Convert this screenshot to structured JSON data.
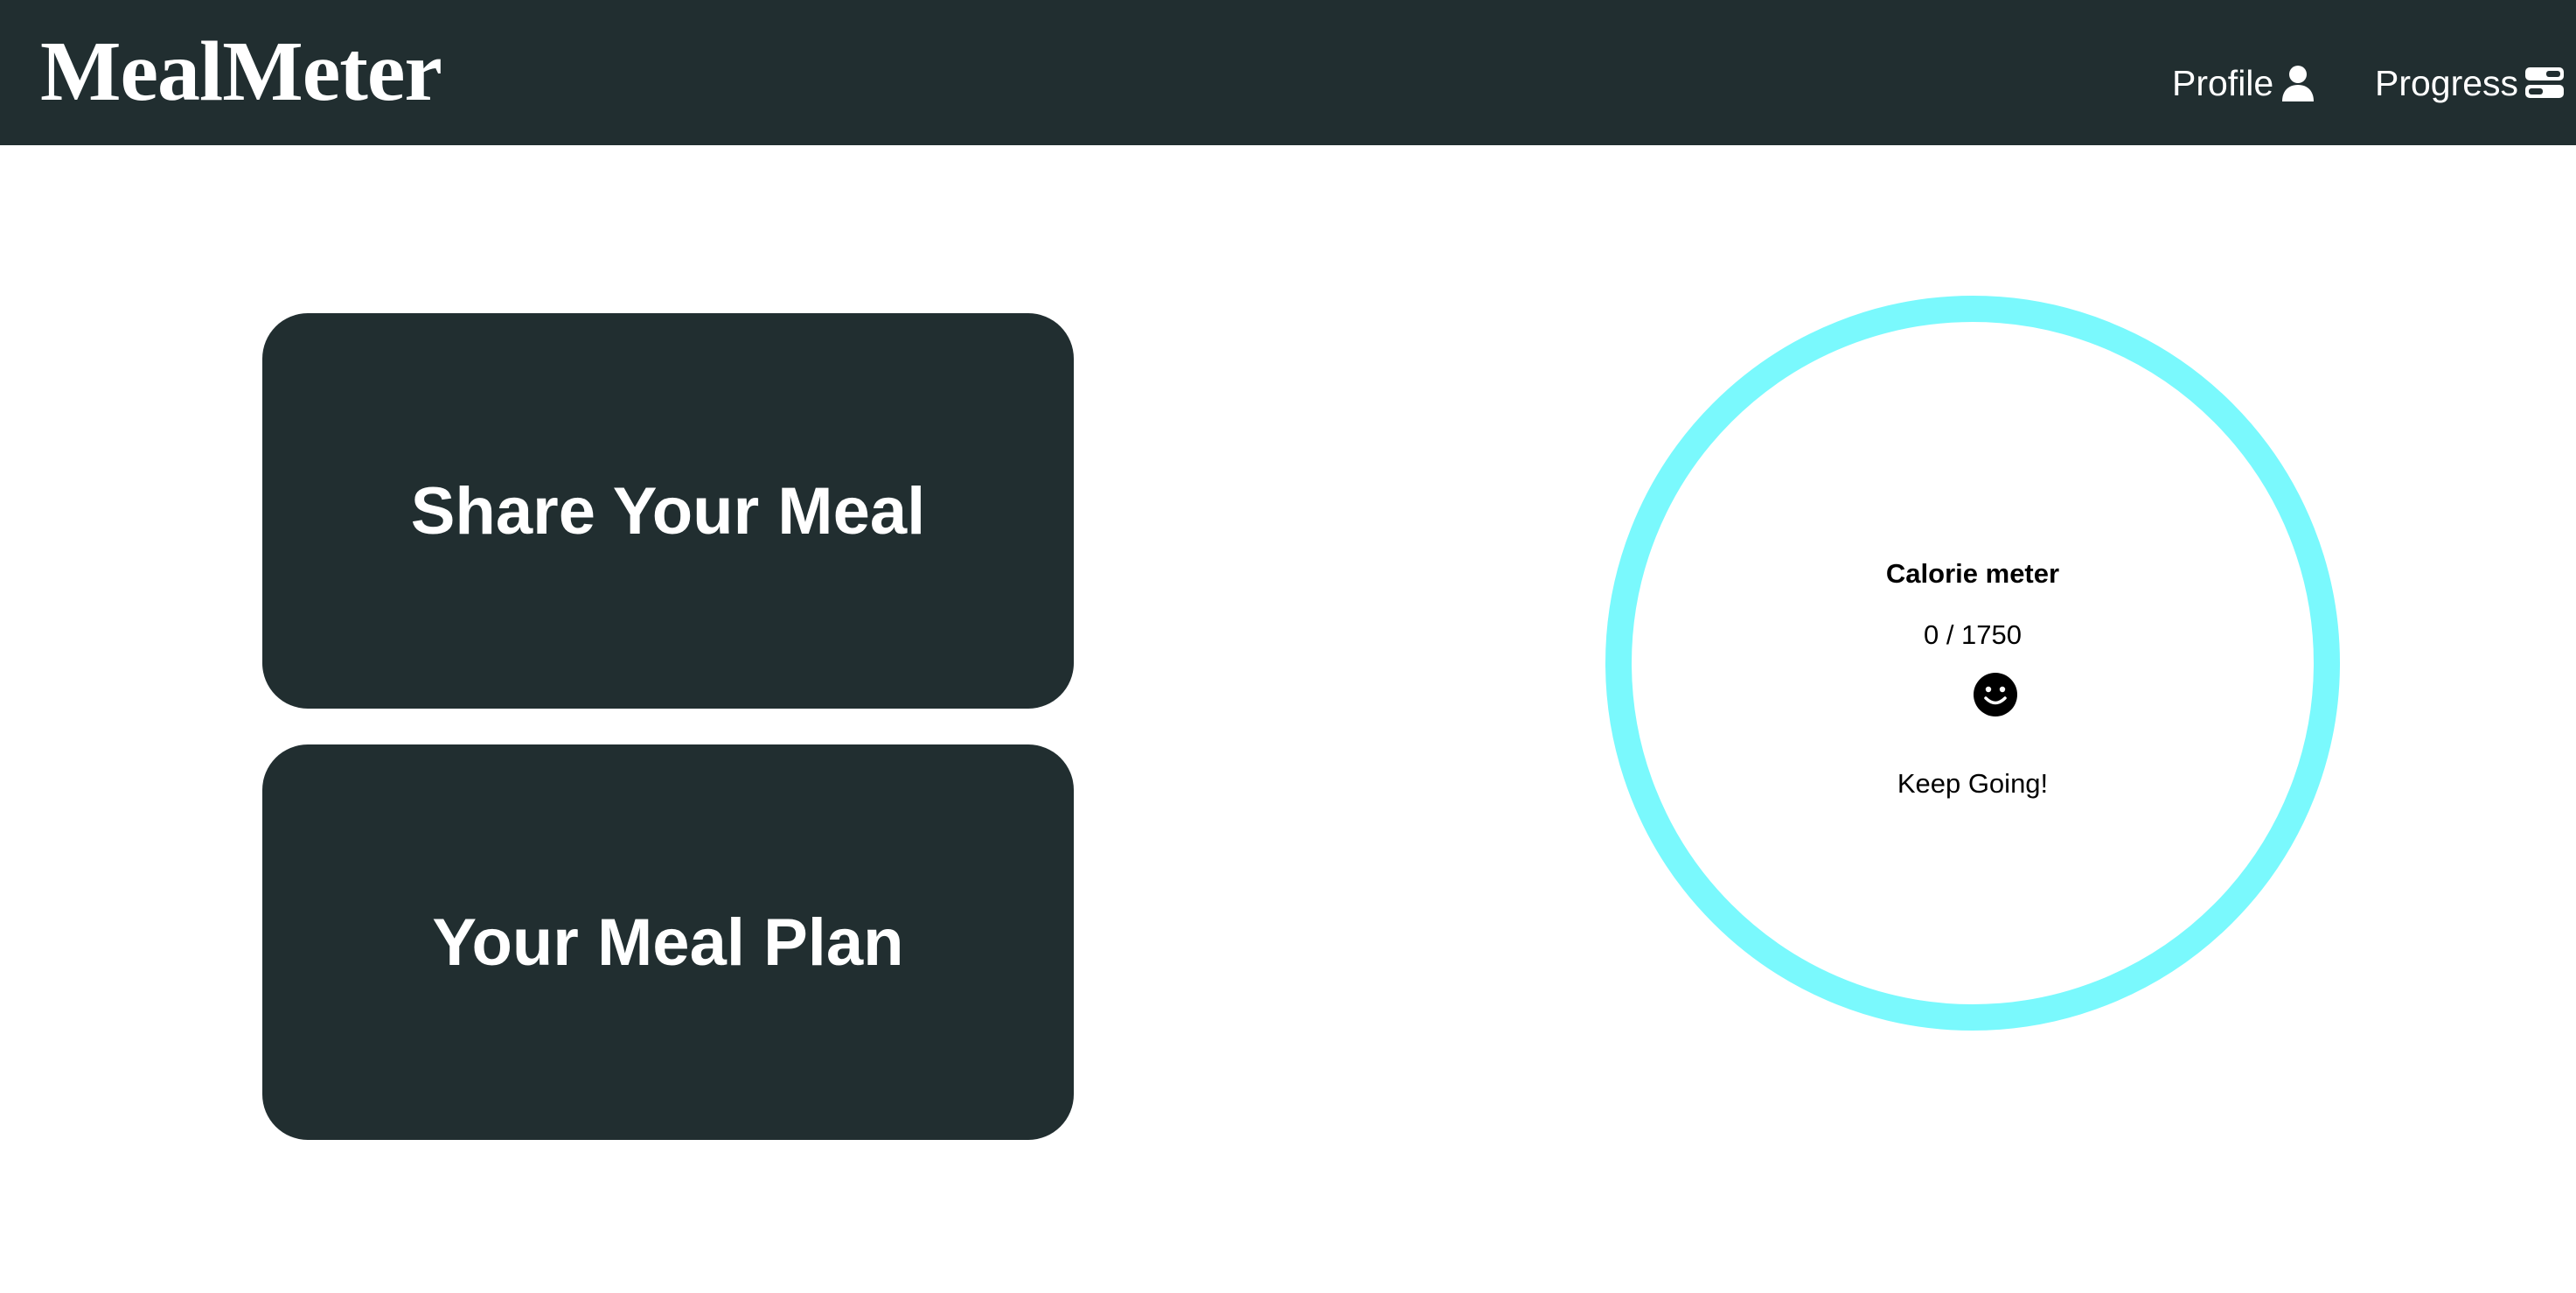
{
  "header": {
    "logo": "MealMeter",
    "nav": [
      {
        "label": "Profile",
        "icon": "user-icon"
      },
      {
        "label": "Progress",
        "icon": "progress-icon"
      }
    ]
  },
  "cards": {
    "share_label": "Share Your Meal",
    "plan_label": "Your Meal Plan"
  },
  "calorie_meter": {
    "title": "Calorie meter",
    "value": "0 / 1750",
    "consumed": 0,
    "goal": 1750,
    "face_icon": "smiley-face-icon",
    "status": "Keep Going!"
  },
  "colors": {
    "nav_background": "#212e30",
    "card_background": "#212e30",
    "meter_ring": "#7af9fd",
    "text_light": "#ffffff",
    "text_dark": "#000000"
  }
}
